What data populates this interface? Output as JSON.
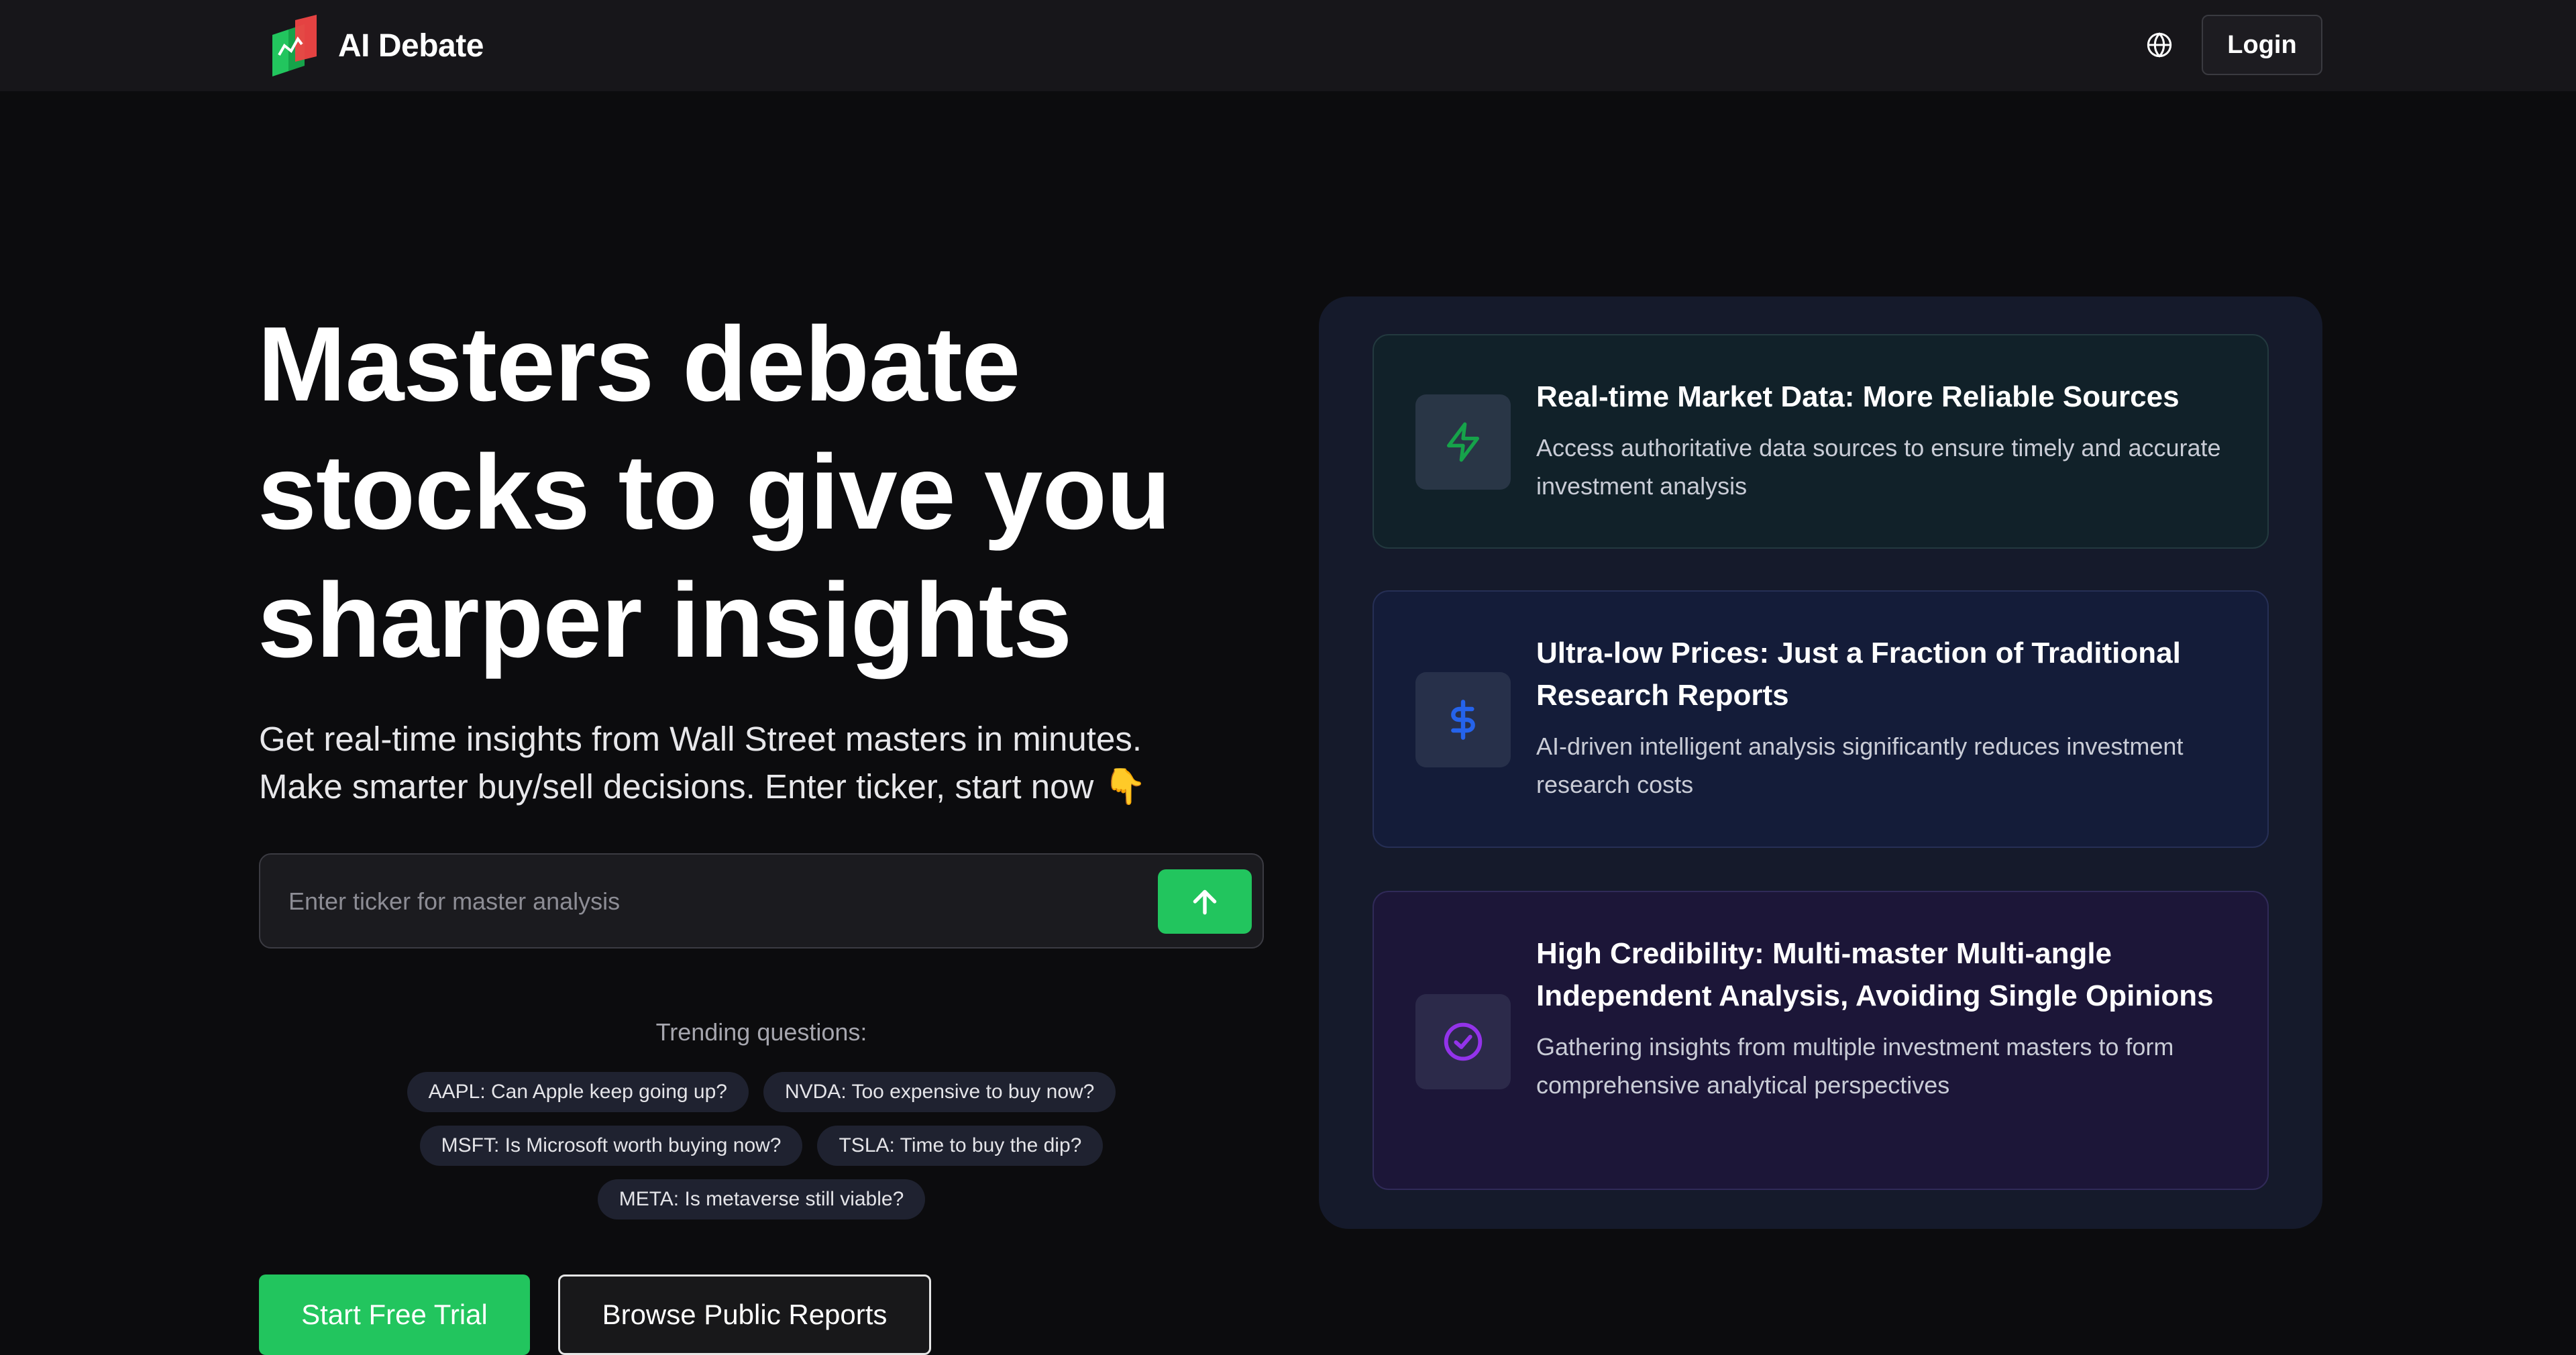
{
  "header": {
    "brand_name": "AI Debate",
    "language_icon": "globe-icon",
    "login_label": "Login"
  },
  "hero": {
    "title_lines": [
      "Masters debate",
      "stocks to give you",
      "sharper insights"
    ],
    "subtitle_line1": "Get real-time insights from Wall Street masters in minutes.",
    "subtitle_line2": "Make smarter buy/sell decisions. Enter ticker, start now",
    "subtitle_emoji": "👇"
  },
  "search": {
    "placeholder": "Enter ticker for master analysis",
    "value": "",
    "submit_icon": "arrow-up-icon"
  },
  "trending": {
    "label": "Trending questions:",
    "questions": [
      "AAPL: Can Apple keep going up?",
      "NVDA: Too expensive to buy now?",
      "MSFT: Is Microsoft worth buying now?",
      "TSLA: Time to buy the dip?",
      "META: Is metaverse still viable?"
    ]
  },
  "cta": {
    "primary_label": "Start Free Trial",
    "secondary_label": "Browse Public Reports"
  },
  "features": [
    {
      "icon": "lightning-icon",
      "title": "Real-time Market Data: More Reliable Sources",
      "description": "Access authoritative data sources to ensure timely and accurate investment analysis"
    },
    {
      "icon": "dollar-icon",
      "title": "Ultra-low Prices: Just a Fraction of Traditional Research Reports",
      "description": "AI-driven intelligent analysis significantly reduces investment research costs"
    },
    {
      "icon": "check-circle-icon",
      "title": "High Credibility: Multi-master Multi-angle Independent Analysis, Avoiding Single Opinions",
      "description": "Gathering insights from multiple investment masters to form comprehensive analytical perspectives"
    }
  ],
  "colors": {
    "accent_green": "#22c55e",
    "logo_red": "#ef4444",
    "background": "#0c0c0e",
    "header_background": "#17161a",
    "panel_background": "#151a2b",
    "icon_lightning": "#16a34a",
    "icon_dollar": "#2563eb",
    "icon_check": "#9333ea"
  }
}
